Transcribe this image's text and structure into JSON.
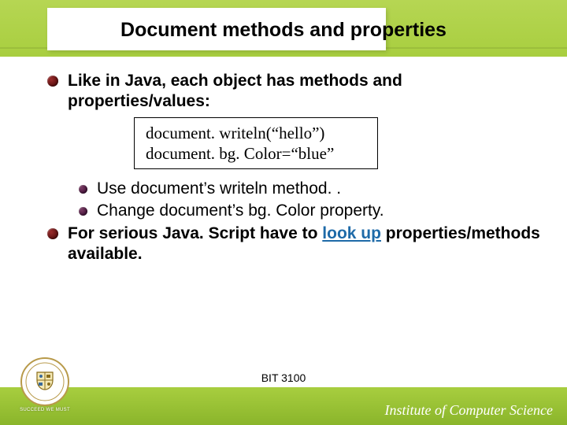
{
  "slide": {
    "title": "Document methods and properties",
    "bullets": {
      "b1": "Like in Java, each object has methods and properties/values:",
      "code1": "document. writeln(“hello”)",
      "code2": "document. bg. Color=“blue”",
      "sub1": "Use document’s writeln method. .",
      "sub2": "Change document’s bg. Color property.",
      "b2_pre": "For serious Java. Script have to ",
      "b2_link": "look up",
      "b2_post": " properties/methods available."
    },
    "footer_code": "BIT 3100",
    "institute": "Institute of Computer Science",
    "motto": "SUCCEED WE MUST"
  }
}
